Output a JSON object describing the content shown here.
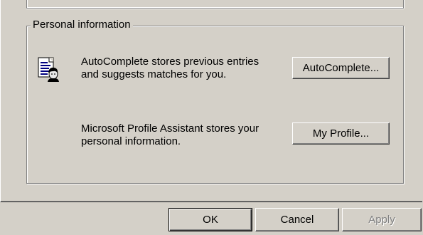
{
  "group": {
    "legend": "Personal information"
  },
  "autocomplete": {
    "description_line1": "AutoComplete stores previous entries",
    "description_line2": "and suggests matches for you.",
    "button_label": "AutoComplete..."
  },
  "profile": {
    "description_line1": "Microsoft Profile Assistant stores your",
    "description_line2": "personal information.",
    "button_label": "My Profile..."
  },
  "dialog_buttons": {
    "ok": "OK",
    "cancel": "Cancel",
    "apply": "Apply"
  },
  "icons": {
    "personal_info": "document-with-person-icon"
  }
}
